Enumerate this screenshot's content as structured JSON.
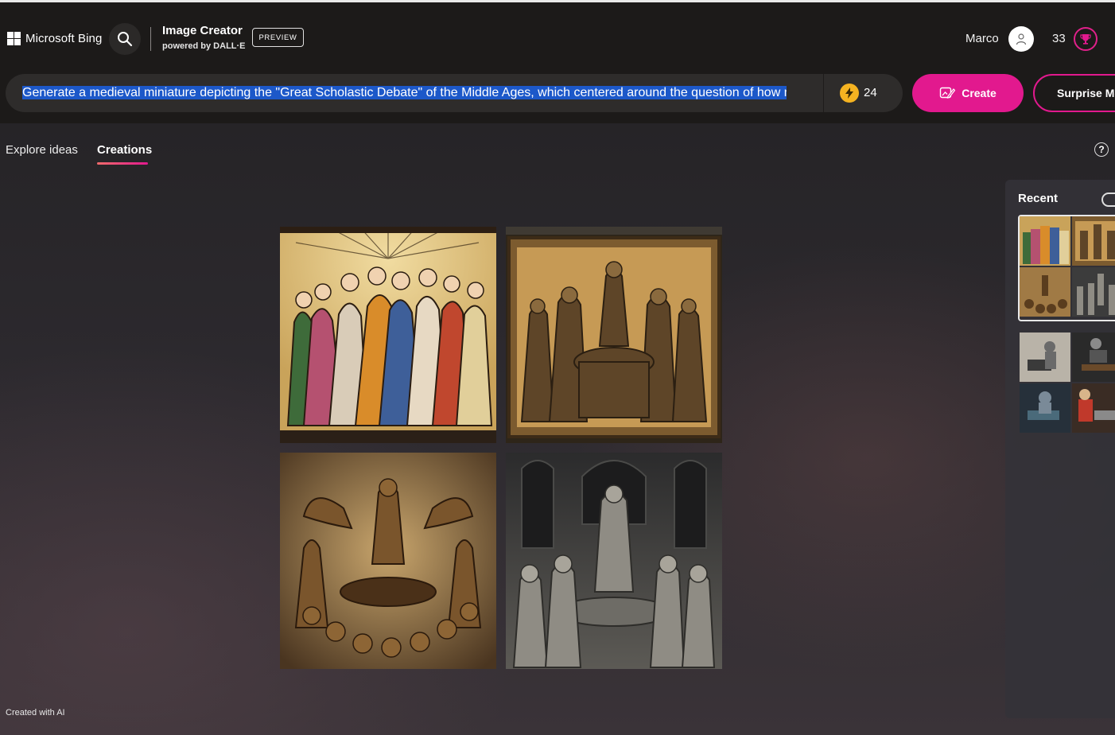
{
  "header": {
    "brand": "Microsoft Bing",
    "app_title": "Image Creator",
    "app_subtitle": "powered by DALL·E",
    "preview_badge": "PREVIEW",
    "user_name": "Marco",
    "reward_points": "33"
  },
  "prompt": {
    "value": "Generate a medieval miniature depicting the \"Great Scholastic Debate\" of the Middle Ages, which centered around the question of how many angels can dance on the head of a pin",
    "boost_count": "24",
    "create_label": "Create",
    "surprise_label": "Surprise Me"
  },
  "tabs": {
    "explore": "Explore ideas",
    "creations": "Creations"
  },
  "help_glyph": "?",
  "recent": {
    "title": "Recent"
  },
  "footer": {
    "created_with_ai": "Created with AI"
  },
  "images": [
    {
      "name": "image-1",
      "style": "illuminated-painting"
    },
    {
      "name": "image-2",
      "style": "bronze-relief"
    },
    {
      "name": "image-3",
      "style": "carved-relief"
    },
    {
      "name": "image-4",
      "style": "pewter-figures"
    }
  ],
  "colors": {
    "accent": "#e2198e",
    "selection": "#1c58c9",
    "boost": "#f5b321",
    "header_bg": "#1c1a19"
  }
}
